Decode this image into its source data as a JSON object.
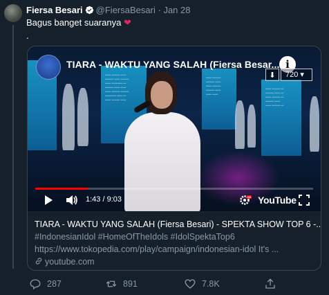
{
  "tweet": {
    "author_name": "Fiersa Besari",
    "handle": "@FiersaBesari",
    "separator": "·",
    "date": "Jan 28",
    "text": "Bagus banget suaranya",
    "emoji": "❤",
    "extra_line": "."
  },
  "video": {
    "title": "TIARA - WAKTU YANG SALAH (Fiersa Besar...",
    "quality": "720",
    "current_time": "1:43",
    "duration": "9:03",
    "time_display": "1:43 / 9:03",
    "progress": 0.19,
    "youtube_label": "YouTube",
    "hd_badge": "HD"
  },
  "card": {
    "title": "TIARA - WAKTU YANG SALAH (Fiersa Besari) - SPEKTA SHOW TOP 6 -...",
    "hashtags": "#IndonesianIdol #HomeOfTheIdols #IdolSpektaTop6",
    "description": "https://www.tokopedia.com/play/campaign/indonesian-idol It's ...",
    "domain": "youtube.com"
  },
  "actions": {
    "replies": "287",
    "retweets": "891",
    "likes": "7.8K"
  },
  "colors": {
    "background": "#15202b",
    "secondary_text": "#8899a6",
    "border": "#38444d",
    "verified": "#1da1f2",
    "heart": "#e0245e",
    "progress": "#ff0000"
  }
}
